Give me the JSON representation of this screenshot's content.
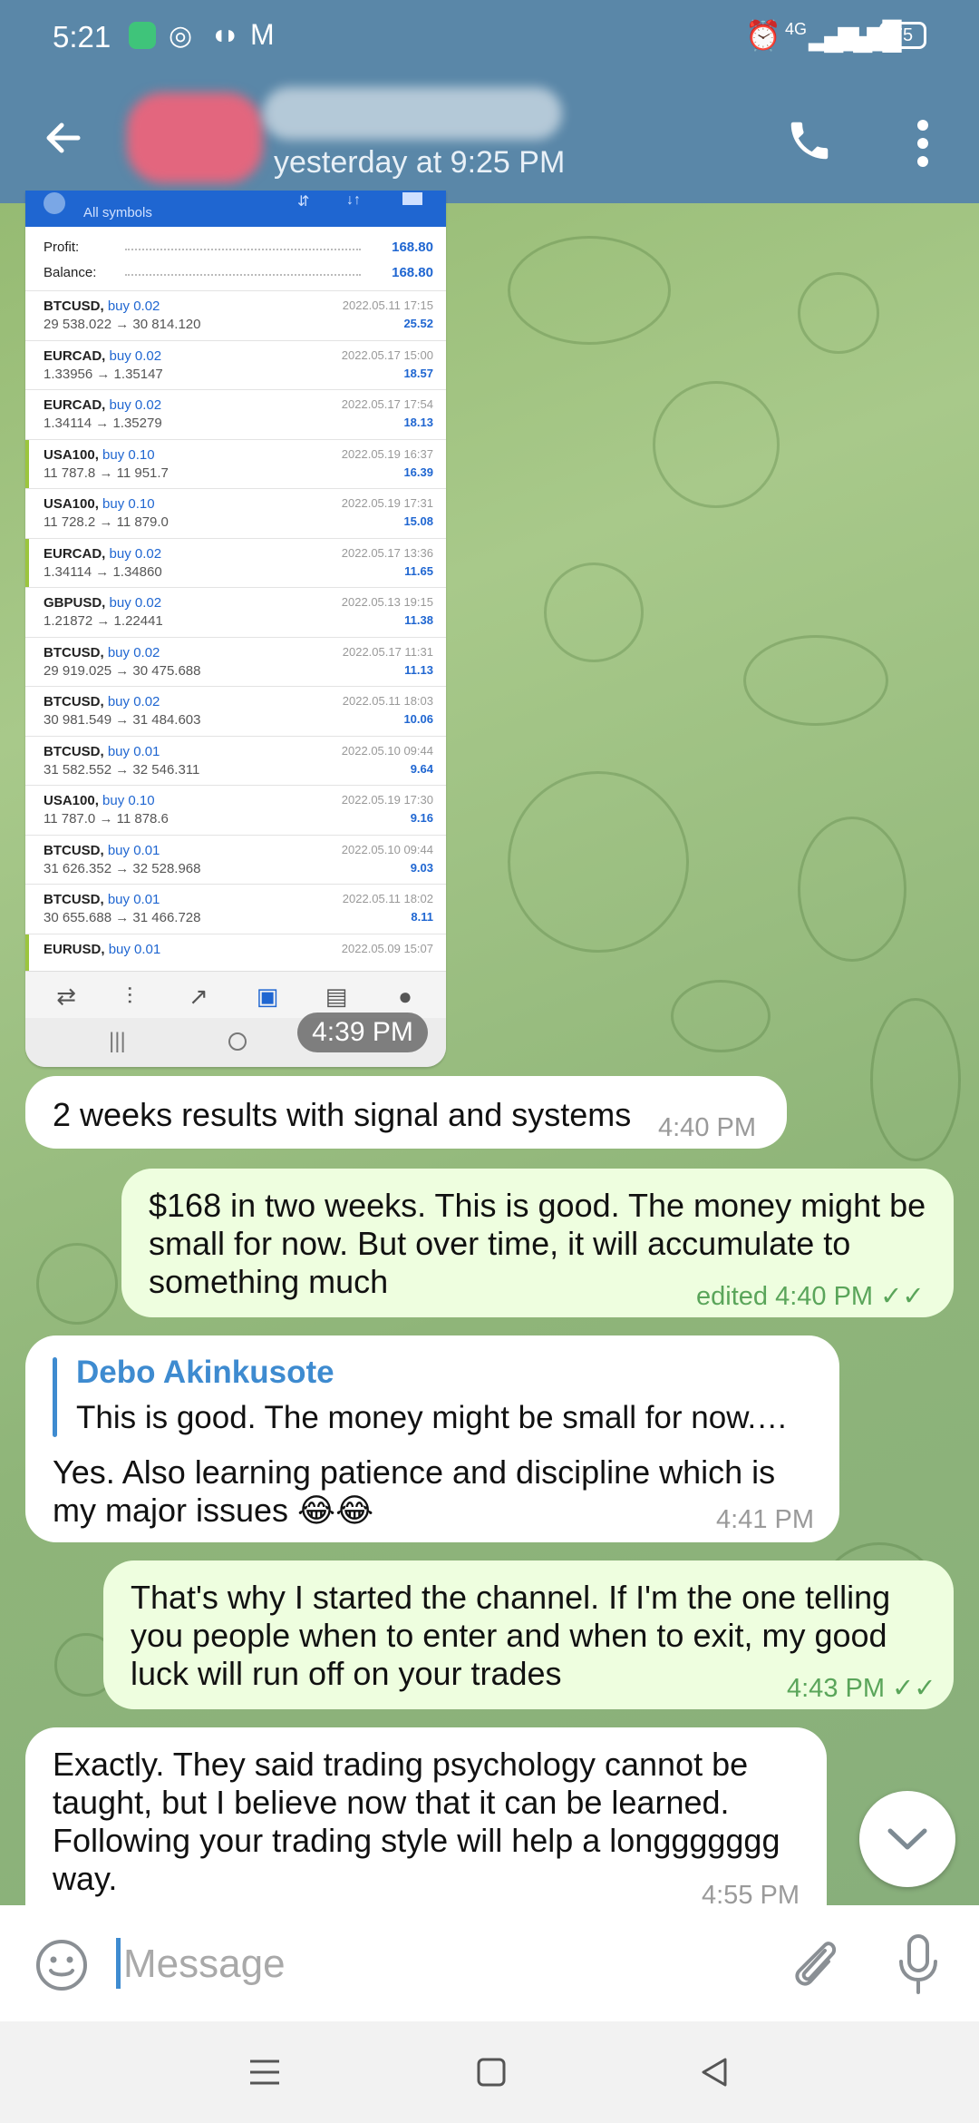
{
  "status_bar": {
    "time": "5:21",
    "network": "4G",
    "battery": "75"
  },
  "header": {
    "subtitle": "yesterday at 9:25 PM"
  },
  "screenshot": {
    "tab_label": "All symbols",
    "profit_label": "Profit:",
    "profit_value": "168.80",
    "balance_label": "Balance:",
    "balance_value": "168.80",
    "trades": [
      {
        "symbol": "BTCUSD,",
        "side": "buy 0.02",
        "prices": "29 538.022 → 30 814.120",
        "date": "2022.05.11 17:15",
        "profit": "25.52",
        "marked": false
      },
      {
        "symbol": "EURCAD,",
        "side": "buy 0.02",
        "prices": "1.33956 → 1.35147",
        "date": "2022.05.17 15:00",
        "profit": "18.57",
        "marked": false
      },
      {
        "symbol": "EURCAD,",
        "side": "buy 0.02",
        "prices": "1.34114 → 1.35279",
        "date": "2022.05.17 17:54",
        "profit": "18.13",
        "marked": false
      },
      {
        "symbol": "USA100,",
        "side": "buy 0.10",
        "prices": "11 787.8 → 11 951.7",
        "date": "2022.05.19 16:37",
        "profit": "16.39",
        "marked": true
      },
      {
        "symbol": "USA100,",
        "side": "buy 0.10",
        "prices": "11 728.2 → 11 879.0",
        "date": "2022.05.19 17:31",
        "profit": "15.08",
        "marked": false
      },
      {
        "symbol": "EURCAD,",
        "side": "buy 0.02",
        "prices": "1.34114 → 1.34860",
        "date": "2022.05.17 13:36",
        "profit": "11.65",
        "marked": true
      },
      {
        "symbol": "GBPUSD,",
        "side": "buy 0.02",
        "prices": "1.21872 → 1.22441",
        "date": "2022.05.13 19:15",
        "profit": "11.38",
        "marked": false
      },
      {
        "symbol": "BTCUSD,",
        "side": "buy 0.02",
        "prices": "29 919.025 → 30 475.688",
        "date": "2022.05.17 11:31",
        "profit": "11.13",
        "marked": false
      },
      {
        "symbol": "BTCUSD,",
        "side": "buy 0.02",
        "prices": "30 981.549 → 31 484.603",
        "date": "2022.05.11 18:03",
        "profit": "10.06",
        "marked": false
      },
      {
        "symbol": "BTCUSD,",
        "side": "buy 0.01",
        "prices": "31 582.552 → 32 546.311",
        "date": "2022.05.10 09:44",
        "profit": "9.64",
        "marked": false
      },
      {
        "symbol": "USA100,",
        "side": "buy 0.10",
        "prices": "11 787.0 → 11 878.6",
        "date": "2022.05.19 17:30",
        "profit": "9.16",
        "marked": false
      },
      {
        "symbol": "BTCUSD,",
        "side": "buy 0.01",
        "prices": "31 626.352 → 32 528.968",
        "date": "2022.05.10 09:44",
        "profit": "9.03",
        "marked": false
      },
      {
        "symbol": "BTCUSD,",
        "side": "buy 0.01",
        "prices": "30 655.688 → 31 466.728",
        "date": "2022.05.11 18:02",
        "profit": "8.11",
        "marked": false
      },
      {
        "symbol": "EURUSD,",
        "side": "buy 0.01",
        "prices": "",
        "date": "2022.05.09 15:07",
        "profit": "",
        "marked": true
      }
    ],
    "time": "4:39 PM"
  },
  "messages": [
    {
      "text": "2 weeks results with signal and systems",
      "time": "4:40 PM"
    },
    {
      "text": "$168 in two weeks. This is good. The money might be small for now. But over time, it will accumulate to something much",
      "time": "edited 4:40 PM"
    },
    {
      "reply_name": "Debo Akinkusote",
      "reply_text": "This is good. The money might be small for now.…",
      "text": "Yes.  Also learning patience and discipline which is my major issues 😂😂",
      "time": "4:41 PM"
    },
    {
      "text": "That's why I started the channel. If I'm the one telling you people when to enter and when to exit, my good luck will run off on your trades",
      "time": "4:43 PM"
    },
    {
      "text": "Exactly. They said trading psychology cannot be taught, but I believe now that it can be learned. Following your trading style will help a longgggggg way.",
      "time": "4:55 PM"
    }
  ],
  "input": {
    "placeholder": "Message"
  },
  "colors": {
    "header": "#5a87a8",
    "incoming_bubble": "#ffffff",
    "outgoing_bubble": "#eefedf",
    "accent": "#3e8bd0",
    "read_ticks": "#5aa55a"
  }
}
